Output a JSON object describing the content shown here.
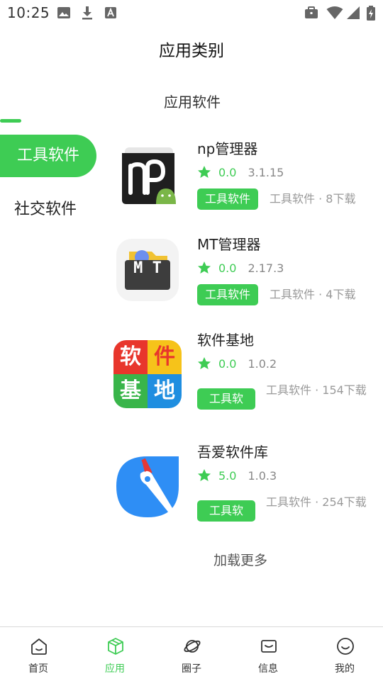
{
  "status_bar": {
    "time": "10:25",
    "left_icons": [
      "image-icon",
      "download-icon",
      "font-icon"
    ],
    "right_icons": [
      "briefcase-icon",
      "wifi-icon",
      "signal-icon",
      "battery-icon"
    ]
  },
  "header": {
    "title": "应用类别"
  },
  "sidebar": {
    "items": [
      {
        "label": "工具软件",
        "active": true
      },
      {
        "label": "社交软件",
        "active": false
      }
    ]
  },
  "section_title": "应用软件",
  "apps": [
    {
      "name": "np管理器",
      "rating": "0.0",
      "version": "3.1.15",
      "tag": "工具软件",
      "meta": "工具软件 · 8下载"
    },
    {
      "name": "MT管理器",
      "rating": "0.0",
      "version": "2.17.3",
      "tag": "工具软件",
      "meta": "工具软件 · 4下载"
    },
    {
      "name": "软件基地",
      "rating": "0.0",
      "version": "1.0.2",
      "tag": "工具软",
      "meta": "工具软件 · 154下载"
    },
    {
      "name": "吾爱软件库",
      "rating": "5.0",
      "version": "1.0.3",
      "tag": "工具软",
      "meta": "工具软件 · 254下载"
    }
  ],
  "icon_texts": {
    "mt": "M T",
    "base": [
      "软",
      "件",
      "基",
      "地"
    ]
  },
  "load_more": "加载更多",
  "bottom_nav": [
    {
      "label": "首页",
      "icon": "home-icon",
      "active": false
    },
    {
      "label": "应用",
      "icon": "cube-icon",
      "active": true
    },
    {
      "label": "圈子",
      "icon": "planet-icon",
      "active": false
    },
    {
      "label": "信息",
      "icon": "message-icon",
      "active": false
    },
    {
      "label": "我的",
      "icon": "smile-icon",
      "active": false
    }
  ],
  "colors": {
    "accent": "#3ecc54",
    "text": "#222222",
    "muted": "#999999"
  }
}
